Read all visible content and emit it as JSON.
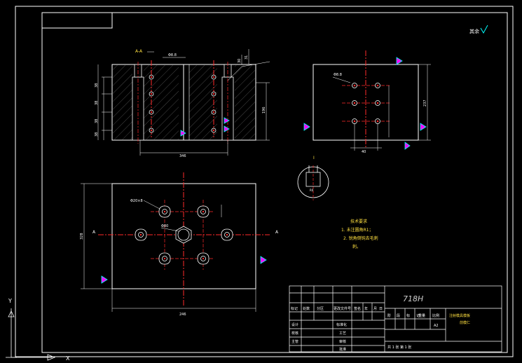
{
  "drawing": {
    "section_label": "A-A",
    "left_view_dims": {
      "hole_dia": "Φ8.8",
      "pitch_labels": [
        "38",
        "38",
        "38",
        "38"
      ],
      "height": "196",
      "width": "346",
      "top_small": "31",
      "top_small2": "30"
    },
    "right_view_dims": {
      "hole_dia": "Φ8.8",
      "height": "237",
      "width": "40"
    },
    "plan_view_dims": {
      "hole_callout": "Φ20×8",
      "center_callout": "Φ80",
      "height": "328",
      "width": "246"
    },
    "detail_label": "I",
    "detail_dim": "R0",
    "section_arrow_left": "A",
    "section_arrow_right": "A",
    "tech_requirements": {
      "title": "技术要求",
      "line1": "1. 未注圆角R1；",
      "line2": "2. 锐角倒钝去毛刺",
      "line3": "刺。"
    },
    "roughness_note": "其余"
  },
  "title_block": {
    "material": "718H",
    "scale_label": "比例",
    "stage_headers": [
      "阶",
      "段",
      "标",
      "记",
      "重量",
      "比例"
    ],
    "sheet_size": "A2",
    "part_name_line1": "注射模具模板",
    "part_name_line2": "前模仁",
    "row_labels": [
      "标记",
      "处数",
      "分区",
      "更改文件号",
      "签名",
      "年",
      "月",
      "日"
    ],
    "sign_rows": [
      "设计",
      "校核",
      "主管"
    ],
    "standardize": "标准化",
    "process": "工艺",
    "review": "审核",
    "approve": "批准",
    "sheet_info": "共 1 张  第 1 张"
  },
  "ucs": {
    "y_label": "Y",
    "x_label": "X"
  }
}
